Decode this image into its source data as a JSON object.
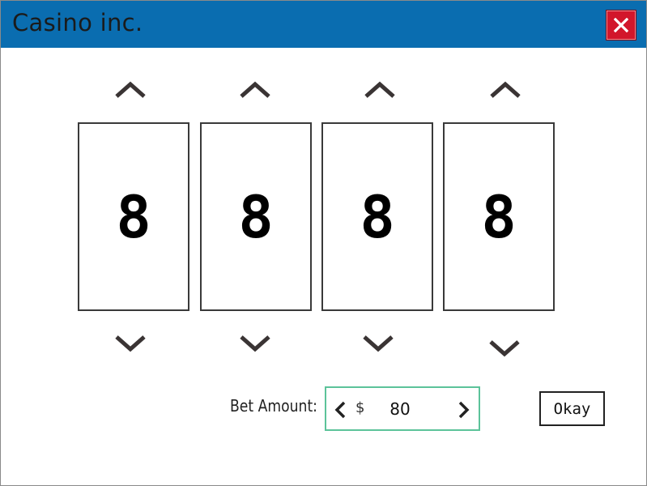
{
  "window": {
    "title": "Casino inc.",
    "close_icon": "close-icon",
    "close_color": "#d2162b",
    "titlebar_color": "#0a6db0"
  },
  "reels": [
    {
      "value": "8",
      "up_icon": "chevron-up-icon",
      "down_icon": "chevron-down-icon"
    },
    {
      "value": "8",
      "up_icon": "chevron-up-icon",
      "down_icon": "chevron-down-icon"
    },
    {
      "value": "8",
      "up_icon": "chevron-up-icon",
      "down_icon": "chevron-down-icon"
    },
    {
      "value": "8",
      "up_icon": "chevron-up-icon",
      "down_icon": "chevron-down-icon"
    }
  ],
  "bet": {
    "label": "Bet Amount:",
    "currency": "$",
    "value": "80",
    "prev_icon": "chevron-left-icon",
    "next_icon": "chevron-right-icon",
    "border_color": "#5cc39a"
  },
  "actions": {
    "okay_label": "Okay"
  }
}
